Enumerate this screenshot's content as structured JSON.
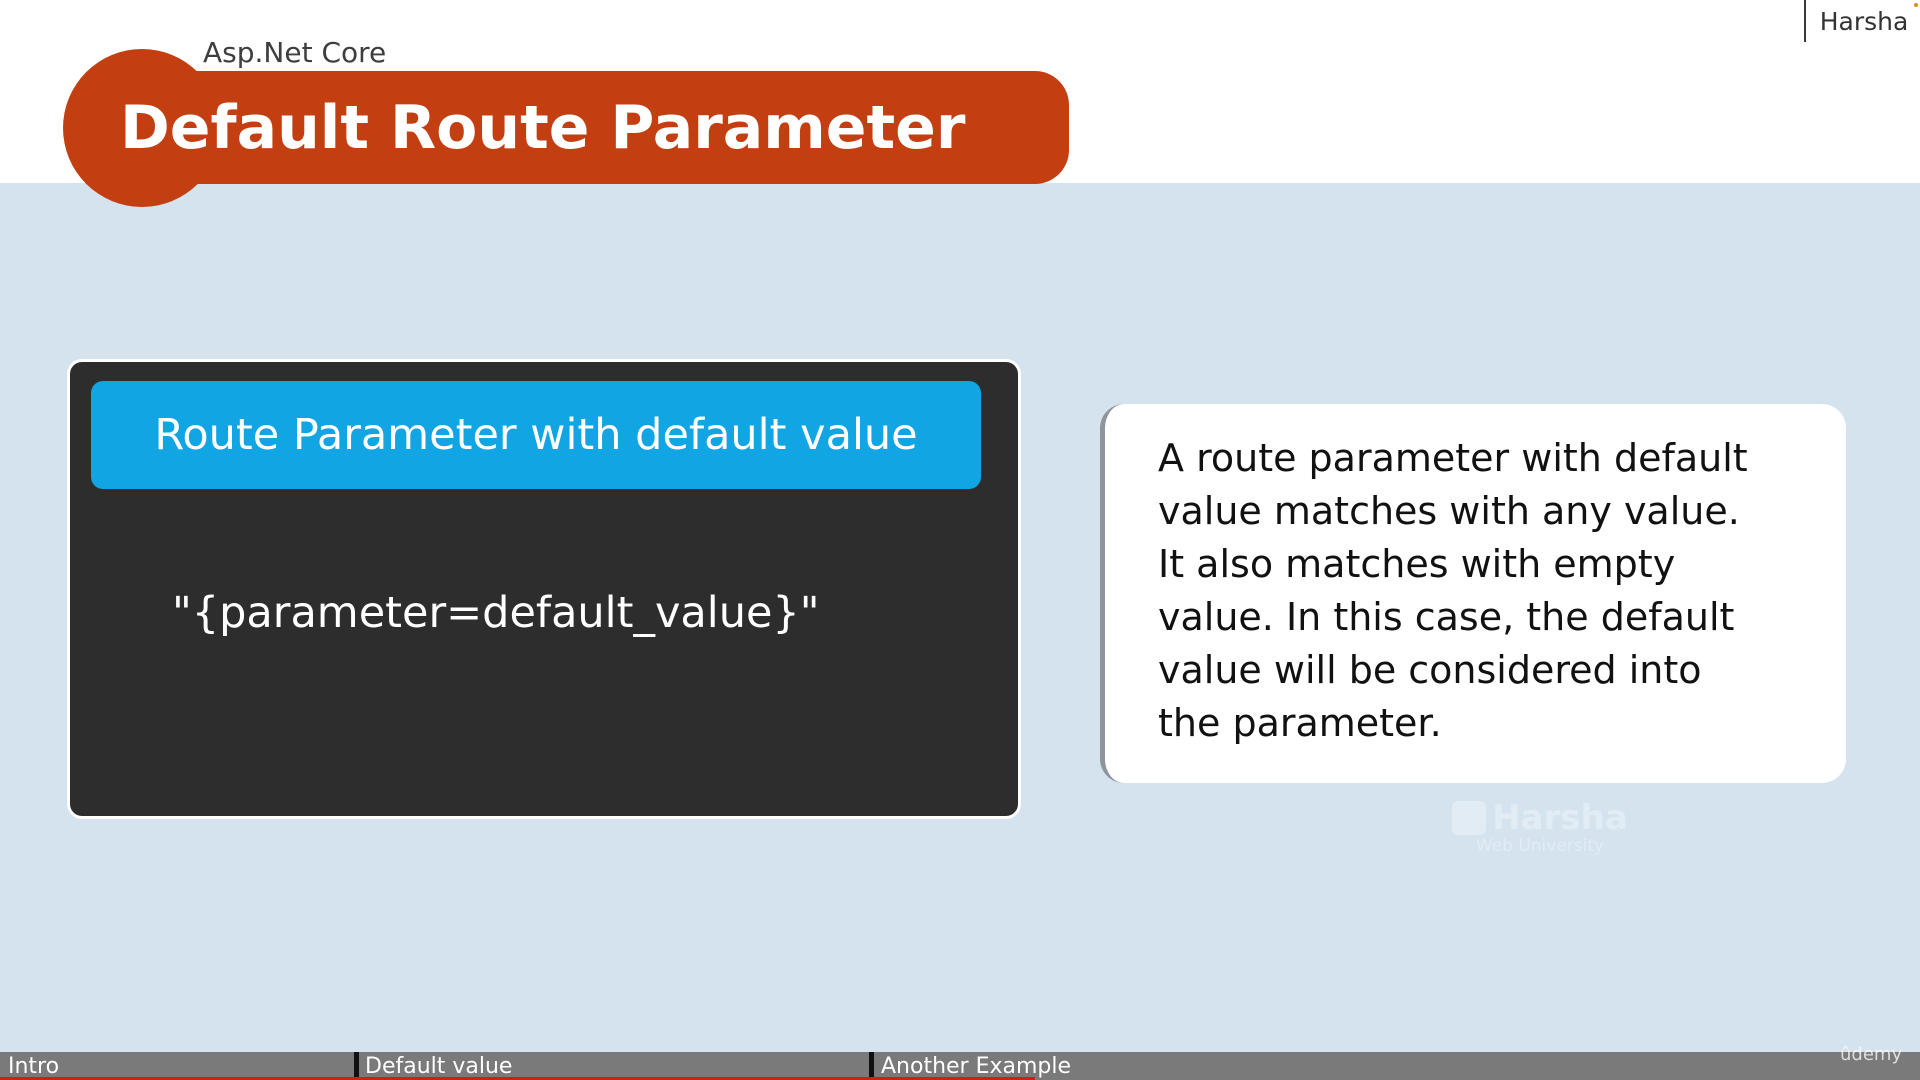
{
  "header": {
    "subject": "Asp.Net Core",
    "title": "Default Route Parameter",
    "brand_corner": "Harsha",
    "accent_color": "#c33f12"
  },
  "code_card": {
    "heading": "Route Parameter with default value",
    "syntax": "\"{parameter=default_value}\"",
    "heading_color": "#11a5e3",
    "background_color": "#2d2d2d"
  },
  "description": {
    "lines": [
      "A route parameter with default",
      "value matches with any value.",
      "It also matches with empty",
      "value. In this case, the default",
      "value will be considered into",
      "the parameter."
    ]
  },
  "watermark": {
    "name": "Harsha",
    "subtitle": "Web University"
  },
  "chapters": [
    {
      "label": "Intro"
    },
    {
      "label": "Default value"
    },
    {
      "label": "Another Example"
    }
  ],
  "player_brand": "ûdemy",
  "progress_color": "#cc1f1f"
}
